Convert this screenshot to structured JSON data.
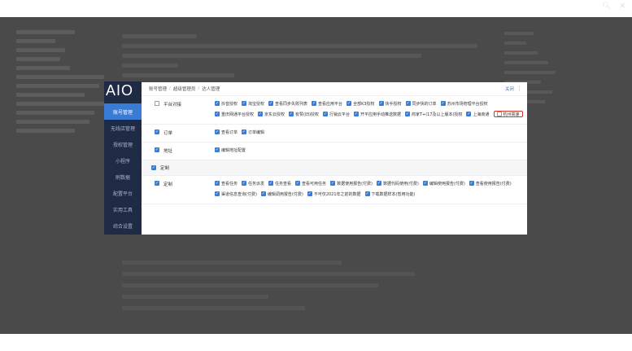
{
  "window": {
    "icons": [
      "search-icon",
      "close-icon"
    ]
  },
  "aio": {
    "logo": "AIO",
    "nav": [
      {
        "label": "账号管理",
        "active": true
      },
      {
        "label": "无线店管理",
        "active": false
      },
      {
        "label": "授权管理",
        "active": false
      },
      {
        "label": "小程序",
        "active": false
      },
      {
        "label": "刷数据",
        "active": false
      },
      {
        "label": "配置平台",
        "active": false
      },
      {
        "label": "实用工具",
        "active": false
      },
      {
        "label": "综合设置",
        "active": false
      }
    ]
  },
  "modal": {
    "breadcrumb": [
      "账号管理",
      "超级管理员",
      "达人管理"
    ],
    "action_label": "关闭",
    "rows": [
      {
        "name": "平台对接",
        "checked": false,
        "items": [
          {
            "label": "抖音授权",
            "checked": true
          },
          {
            "label": "淘宝授权",
            "checked": true
          },
          {
            "label": "查看同步失败列表",
            "checked": true
          },
          {
            "label": "查看应用平台",
            "checked": true
          },
          {
            "label": "全部K3授权",
            "checked": true
          },
          {
            "label": "快手授权",
            "checked": true
          },
          {
            "label": "同步快的订单",
            "checked": true
          },
          {
            "label": "苏州市场管理平台授权",
            "checked": true
          },
          {
            "label": "重庆网通平台授权",
            "checked": true
          },
          {
            "label": "京东云授权",
            "checked": true
          },
          {
            "label": "有赞(旧)授权",
            "checked": true
          },
          {
            "label": "行销云平台",
            "checked": true
          },
          {
            "label": "开平应用手动推送数据",
            "checked": true
          },
          {
            "label": "商家T+(17及以上版本)授权",
            "checked": true
          },
          {
            "label": "上海商通",
            "checked": true
          },
          {
            "label": "杭州高速",
            "checked": false,
            "highlight": true
          }
        ]
      },
      {
        "name": "订单",
        "checked": true,
        "items": [
          {
            "label": "查看订单",
            "checked": true
          },
          {
            "label": "订单编辑",
            "checked": true
          }
        ]
      },
      {
        "name": "地址",
        "checked": true,
        "items": [
          {
            "label": "编辑地址配置",
            "checked": true
          }
        ]
      }
    ],
    "section": {
      "label": "定制",
      "checked": true
    },
    "custom_row": {
      "name": "定制",
      "checked": true,
      "items": [
        {
          "label": "查看任务",
          "checked": true
        },
        {
          "label": "任务派发",
          "checked": true
        },
        {
          "label": "任务查看",
          "checked": true
        },
        {
          "label": "查看可用任务",
          "checked": true
        },
        {
          "label": "数据使用报告(付费)",
          "checked": true
        },
        {
          "label": "数据代码使用(付费)",
          "checked": true
        },
        {
          "label": "编辑使用报告(付费)",
          "checked": true
        },
        {
          "label": "查看使用报告(付费)",
          "checked": true
        },
        {
          "label": "渠道信息查询(付费)",
          "checked": true
        },
        {
          "label": "编辑调用报告(付费)",
          "checked": true
        },
        {
          "label": "不可仅2021年之前的数据",
          "checked": true
        },
        {
          "label": "下载数据样本(暂用功能)",
          "checked": true
        }
      ]
    }
  }
}
